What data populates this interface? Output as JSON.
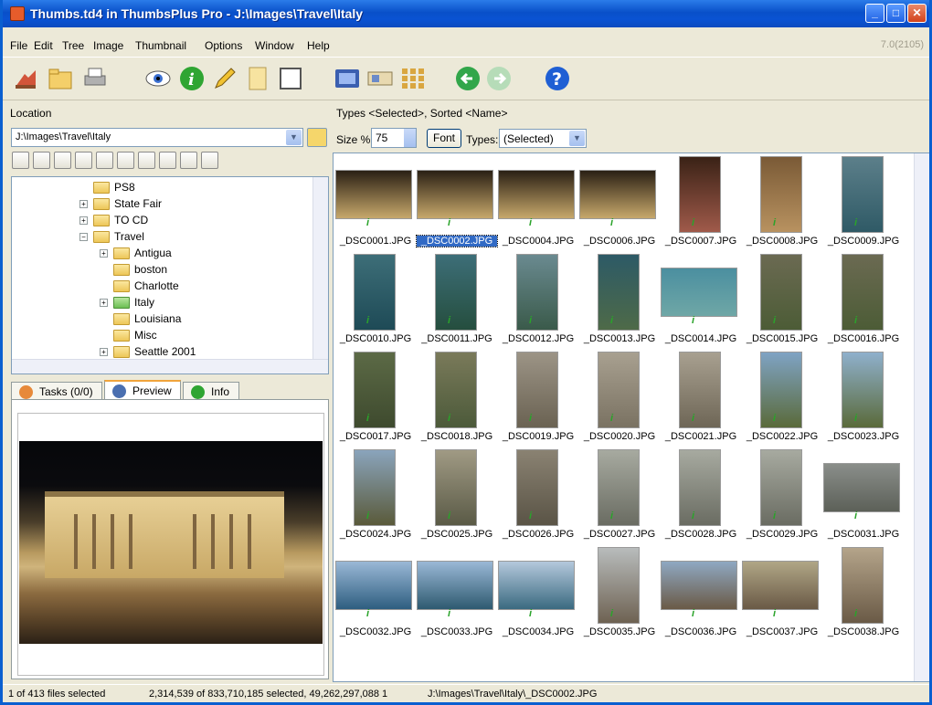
{
  "window": {
    "title": "Thumbs.td4 in ThumbsPlus Pro - J:\\Images\\Travel\\Italy",
    "version": "7.0(2105)"
  },
  "menu": [
    "File",
    "Edit",
    "Tree",
    "Image",
    "Thumbnail",
    "Options",
    "Window",
    "Help"
  ],
  "toolbar_icons": [
    "acquire-icon",
    "open-icon",
    "print-icon",
    "view-eye-icon",
    "info-icon",
    "edit-pencil-icon",
    "new-page-icon",
    "frame-icon",
    "slideshow-icon",
    "compare-icon",
    "contact-sheet-icon",
    "back-arrow-icon",
    "forward-arrow-icon",
    "help-icon"
  ],
  "location": {
    "label": "Location",
    "path": "J:\\Images\\Travel\\Italy"
  },
  "tree": [
    {
      "label": "PS8",
      "expander": "",
      "indent": 1,
      "color": "yellow"
    },
    {
      "label": "State Fair",
      "expander": "+",
      "indent": 1,
      "color": "yellow"
    },
    {
      "label": "TO CD",
      "expander": "+",
      "indent": 1,
      "color": "yellow"
    },
    {
      "label": "Travel",
      "expander": "−",
      "indent": 1,
      "color": "yellow"
    },
    {
      "label": "Antigua",
      "expander": "+",
      "indent": 2,
      "color": "yellow"
    },
    {
      "label": "boston",
      "expander": "",
      "indent": 2,
      "color": "yellow"
    },
    {
      "label": "Charlotte",
      "expander": "",
      "indent": 2,
      "color": "yellow"
    },
    {
      "label": "Italy",
      "expander": "+",
      "indent": 2,
      "color": "green"
    },
    {
      "label": "Louisiana",
      "expander": "",
      "indent": 2,
      "color": "yellow"
    },
    {
      "label": "Misc",
      "expander": "",
      "indent": 2,
      "color": "yellow"
    },
    {
      "label": "Seattle 2001",
      "expander": "+",
      "indent": 2,
      "color": "yellow"
    }
  ],
  "bottom_tabs": {
    "tasks": "Tasks (0/0)",
    "preview": "Preview",
    "info": "Info"
  },
  "gallery": {
    "header": "Types <Selected>, Sorted <Name>",
    "size_label": "Size %",
    "size_value": "75",
    "font_button": "Font",
    "types_label": "Types:",
    "types_value": "(Selected)"
  },
  "files": [
    {
      "name": "_DSC0001.JPG",
      "selected": false,
      "c1": "#2a2014",
      "c2": "#c7a86b",
      "orient": "land"
    },
    {
      "name": "_DSC0002.JPG",
      "selected": true,
      "c1": "#2a2014",
      "c2": "#c7a86b",
      "orient": "land"
    },
    {
      "name": "_DSC0004.JPG",
      "selected": false,
      "c1": "#2a2014",
      "c2": "#c7a86b",
      "orient": "land"
    },
    {
      "name": "_DSC0006.JPG",
      "selected": false,
      "c1": "#2a2014",
      "c2": "#c7a86b",
      "orient": "land"
    },
    {
      "name": "_DSC0007.JPG",
      "selected": false,
      "c1": "#3a2216",
      "c2": "#a05a4a",
      "orient": "port"
    },
    {
      "name": "_DSC0008.JPG",
      "selected": false,
      "c1": "#7a5a36",
      "c2": "#b89260",
      "orient": "port"
    },
    {
      "name": "_DSC0009.JPG",
      "selected": false,
      "c1": "#5c7f8a",
      "c2": "#2f5a66",
      "orient": "port"
    },
    {
      "name": "_DSC0010.JPG",
      "selected": false,
      "c1": "#3d6e78",
      "c2": "#1e4a56",
      "orient": "port"
    },
    {
      "name": "_DSC0011.JPG",
      "selected": false,
      "c1": "#3d6e78",
      "c2": "#254e3e",
      "orient": "port"
    },
    {
      "name": "_DSC0012.JPG",
      "selected": false,
      "c1": "#6a8a90",
      "c2": "#3a5a4a",
      "orient": "port"
    },
    {
      "name": "_DSC0013.JPG",
      "selected": false,
      "c1": "#2d5a66",
      "c2": "#4e6a48",
      "orient": "port"
    },
    {
      "name": "_DSC0014.JPG",
      "selected": false,
      "c1": "#4b8fa0",
      "c2": "#6fa7a6",
      "orient": "land"
    },
    {
      "name": "_DSC0015.JPG",
      "selected": false,
      "c1": "#6b6a52",
      "c2": "#4c5c36",
      "orient": "port"
    },
    {
      "name": "_DSC0016.JPG",
      "selected": false,
      "c1": "#6b6a52",
      "c2": "#4c5c36",
      "orient": "port"
    },
    {
      "name": "_DSC0017.JPG",
      "selected": false,
      "c1": "#5c6a46",
      "c2": "#3e4a2e",
      "orient": "port"
    },
    {
      "name": "_DSC0018.JPG",
      "selected": false,
      "c1": "#7a7a5a",
      "c2": "#4c5a3a",
      "orient": "port"
    },
    {
      "name": "_DSC0019.JPG",
      "selected": false,
      "c1": "#9c9486",
      "c2": "#6a6252",
      "orient": "port"
    },
    {
      "name": "_DSC0020.JPG",
      "selected": false,
      "c1": "#a8a090",
      "c2": "#7a7262",
      "orient": "port"
    },
    {
      "name": "_DSC0021.JPG",
      "selected": false,
      "c1": "#a8a090",
      "c2": "#6e6656",
      "orient": "port"
    },
    {
      "name": "_DSC0022.JPG",
      "selected": false,
      "c1": "#7fa3c4",
      "c2": "#5a6a3a",
      "orient": "port"
    },
    {
      "name": "_DSC0023.JPG",
      "selected": false,
      "c1": "#8fb0cc",
      "c2": "#5a6a3a",
      "orient": "port"
    },
    {
      "name": "_DSC0024.JPG",
      "selected": false,
      "c1": "#8aa4bc",
      "c2": "#5a5a3a",
      "orient": "port"
    },
    {
      "name": "_DSC0025.JPG",
      "selected": false,
      "c1": "#a09a84",
      "c2": "#5a5a46",
      "orient": "port"
    },
    {
      "name": "_DSC0026.JPG",
      "selected": false,
      "c1": "#8a8272",
      "c2": "#5a5446",
      "orient": "port"
    },
    {
      "name": "_DSC0027.JPG",
      "selected": false,
      "c1": "#a7aaa0",
      "c2": "#6a6c62",
      "orient": "port"
    },
    {
      "name": "_DSC0028.JPG",
      "selected": false,
      "c1": "#a7aaa0",
      "c2": "#6a6c62",
      "orient": "port"
    },
    {
      "name": "_DSC0029.JPG",
      "selected": false,
      "c1": "#a7aaa0",
      "c2": "#6a6c62",
      "orient": "port"
    },
    {
      "name": "_DSC0031.JPG",
      "selected": false,
      "c1": "#8a8e8a",
      "c2": "#5c6058",
      "orient": "land"
    },
    {
      "name": "_DSC0032.JPG",
      "selected": false,
      "c1": "#9ab8d6",
      "c2": "#2e5e80",
      "orient": "land"
    },
    {
      "name": "_DSC0033.JPG",
      "selected": false,
      "c1": "#9ab8d6",
      "c2": "#2e5a70",
      "orient": "land"
    },
    {
      "name": "_DSC0034.JPG",
      "selected": false,
      "c1": "#b4c8dc",
      "c2": "#3a6a80",
      "orient": "land"
    },
    {
      "name": "_DSC0035.JPG",
      "selected": false,
      "c1": "#b8bcbc",
      "c2": "#6e6252",
      "orient": "port"
    },
    {
      "name": "_DSC0036.JPG",
      "selected": false,
      "c1": "#8fa8c2",
      "c2": "#6a5a46",
      "orient": "land"
    },
    {
      "name": "_DSC0037.JPG",
      "selected": false,
      "c1": "#b0a686",
      "c2": "#6a5a46",
      "orient": "land"
    },
    {
      "name": "_DSC0038.JPG",
      "selected": false,
      "c1": "#b4a48a",
      "c2": "#6a5a46",
      "orient": "port"
    }
  ],
  "status": {
    "selected": "1 of 413 files selected",
    "sizes": "2,314,539 of 833,710,185 selected, 49,262,297,088 1",
    "path": "J:\\Images\\Travel\\Italy\\_DSC0002.JPG"
  }
}
